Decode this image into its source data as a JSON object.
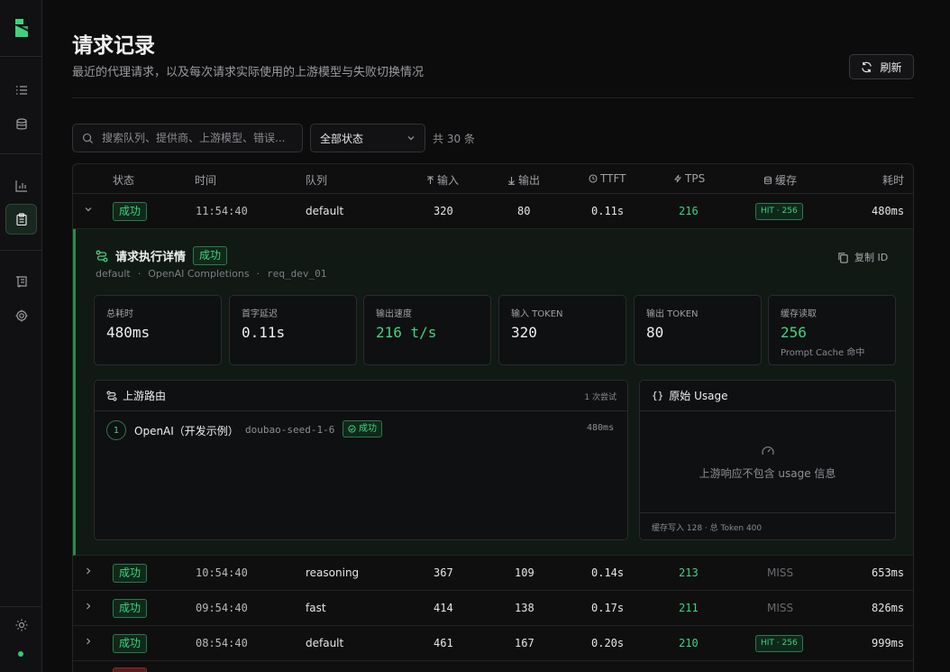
{
  "page": {
    "title": "请求记录",
    "subtitle": "最近的代理请求，以及每次请求实际使用的上游模型与失败切换情况",
    "refresh_label": "刷新"
  },
  "filters": {
    "search_placeholder": "搜索队列、提供商、上游模型、错误...",
    "status_value": "全部状态",
    "count": "共 30 条"
  },
  "table": {
    "headers": {
      "status": "状态",
      "time": "时间",
      "queue": "队列",
      "input": "输入",
      "output": "输出",
      "ttft": "TTFT",
      "tps": "TPS",
      "cache": "缓存",
      "duration": "耗时"
    },
    "rows": [
      {
        "status": "成功",
        "time": "11:54:40",
        "queue": "default",
        "input": "320",
        "output": "80",
        "ttft": "0.11s",
        "tps": "216",
        "cache": "HIT · 256",
        "duration": "480ms"
      },
      {
        "status": "成功",
        "time": "10:54:40",
        "queue": "reasoning",
        "input": "367",
        "output": "109",
        "ttft": "0.14s",
        "tps": "213",
        "cache": "MISS",
        "duration": "653ms"
      },
      {
        "status": "成功",
        "time": "09:54:40",
        "queue": "fast",
        "input": "414",
        "output": "138",
        "ttft": "0.17s",
        "tps": "211",
        "cache": "MISS",
        "duration": "826ms"
      },
      {
        "status": "成功",
        "time": "08:54:40",
        "queue": "default",
        "input": "461",
        "output": "167",
        "ttft": "0.20s",
        "tps": "210",
        "cache": "HIT · 256",
        "duration": "999ms"
      }
    ]
  },
  "detail": {
    "title": "请求执行详情",
    "status": "成功",
    "queue": "default",
    "api": "OpenAI Completions",
    "request_id": "req_dev_01",
    "copy_label": "复制 ID",
    "stats": [
      {
        "label": "总耗时",
        "value": "480ms"
      },
      {
        "label": "首字延迟",
        "value": "0.11s"
      },
      {
        "label": "输出速度",
        "value": "216 t/s"
      },
      {
        "label": "输入 TOKEN",
        "value": "320"
      },
      {
        "label": "输出 TOKEN",
        "value": "80"
      },
      {
        "label": "缓存读取",
        "value": "256",
        "sub": "Prompt Cache 命中"
      }
    ],
    "route": {
      "title": "上游路由",
      "attempts": "1 次尝试",
      "index": "1",
      "provider": "OpenAI（开发示例）",
      "model": "doubao-seed-1-6",
      "status": "成功",
      "time": "480ms"
    },
    "usage": {
      "title": "原始 Usage",
      "empty_text": "上游响应不包含 usage 信息",
      "footer": "缓存写入 128 · 总 Token 400"
    }
  },
  "colors": {
    "accent": "#3ed37f",
    "background": "#0c0c0d",
    "sidebar": "#111113"
  }
}
